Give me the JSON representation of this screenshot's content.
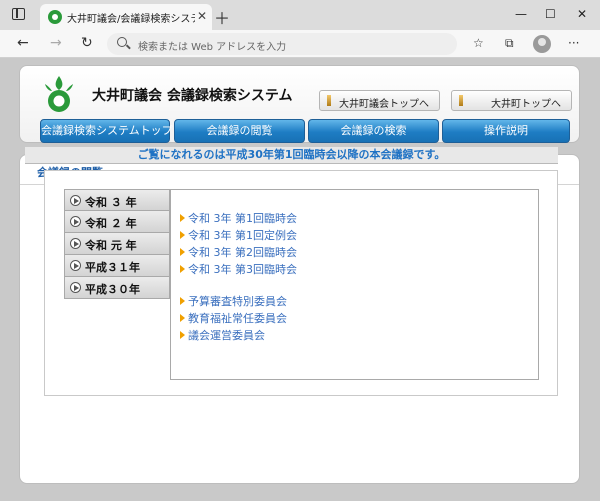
{
  "browser": {
    "tab_title": "大井町議会/会議録検索システム",
    "tab_close": "✕",
    "new_tab": "＋",
    "address_placeholder": "検索または Web アドレスを入力",
    "minimize": "—",
    "maximize": "☐",
    "close": "✕",
    "back": "←",
    "forward": "→",
    "reload": "↻",
    "favorites_icon": "☆",
    "collections_icon": "⧉",
    "more": "···"
  },
  "header": {
    "title": "大井町議会 会議録検索システム",
    "logo_color": "#2a9a3a",
    "top_links": [
      "大井町議会トップへ",
      "大井町トップへ"
    ]
  },
  "nav": {
    "items": [
      "会議録検索システムトップ",
      "会議録の閲覧",
      "会議録の検索",
      "操作説明"
    ]
  },
  "section": {
    "title": "会議録の閲覧",
    "notice": "ご覧になれるのは平成30年第1回臨時会以降の本会議録です。"
  },
  "years": [
    "令和 ３ 年",
    "令和 ２ 年",
    "令和 元 年",
    "平成３１年",
    "平成３０年"
  ],
  "meetings": {
    "plenary": [
      "令和 3年 第1回臨時会",
      "令和 3年 第1回定例会",
      "令和 3年 第2回臨時会",
      "令和 3年 第3回臨時会"
    ],
    "committees": [
      "予算審査特別委員会",
      "教育福祉常任委員会",
      "議会運営委員会"
    ]
  }
}
